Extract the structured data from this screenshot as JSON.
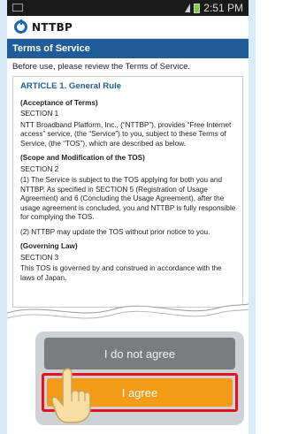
{
  "status_bar": {
    "time": "2:51 PM"
  },
  "header": {
    "logo_text": "NTTBP"
  },
  "title_bar": {
    "title": "Terms of Service"
  },
  "intro": "Before use, please review the Terms of Service.",
  "terms": {
    "article": "ARTICLE 1. General Rule",
    "sections": [
      {
        "heading": "(Acceptance of Terms)",
        "number": "SECTION 1",
        "paragraphs": [
          "NTT Broadband Platform, Inc., (“NTTBP”), provides “Free Internet access” service, (the “Service”) to you, subject to these Terms of Service, (the “TOS”), which are described as below."
        ]
      },
      {
        "heading": "(Scope and Modification of the TOS)",
        "number": "SECTION 2",
        "paragraphs": [
          "(1) The Service is subject to the TOS applying for both you and NTTBP. As specified in SECTION 5 (Registration of Usage Agreement) and 6 (Concluding the Usage Agreement), after the usage agreement is concluded, you and NTTBP is fully responsible for complying the TOS.",
          "(2) NTTBP may update the TOS without prior notice to you."
        ]
      },
      {
        "heading": "(Governing Law)",
        "number": "SECTION 3",
        "paragraphs": [
          "This TOS is governed by and construed in accordance with the laws of Japan."
        ]
      }
    ]
  },
  "buttons": {
    "disagree_label": "I do not agree",
    "agree_label": "I agree"
  },
  "colors": {
    "title_bar": "#1f5c99",
    "agree_button": "#f39a17",
    "agree_highlight": "#e5121d",
    "disagree_button": "#7a7c7d"
  }
}
